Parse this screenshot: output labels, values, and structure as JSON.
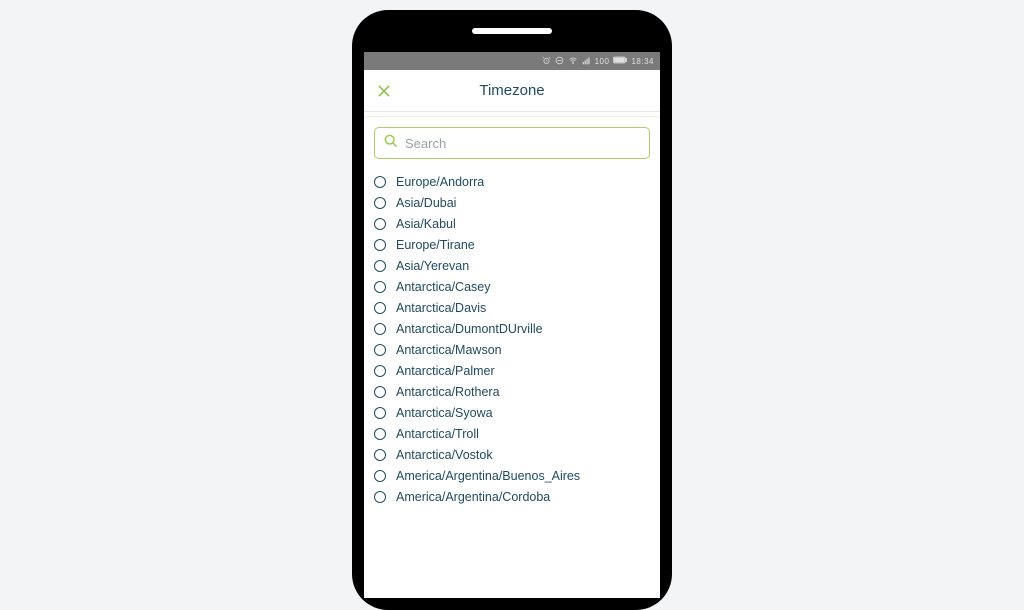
{
  "statusbar": {
    "battery_text": "100",
    "time": "18:34"
  },
  "header": {
    "title": "Timezone"
  },
  "search": {
    "placeholder": "Search"
  },
  "timezones": [
    "Europe/Andorra",
    "Asia/Dubai",
    "Asia/Kabul",
    "Europe/Tirane",
    "Asia/Yerevan",
    "Antarctica/Casey",
    "Antarctica/Davis",
    "Antarctica/DumontDUrville",
    "Antarctica/Mawson",
    "Antarctica/Palmer",
    "Antarctica/Rothera",
    "Antarctica/Syowa",
    "Antarctica/Troll",
    "Antarctica/Vostok",
    "America/Argentina/Buenos_Aires",
    "America/Argentina/Cordoba"
  ],
  "colors": {
    "accent": "#8bc34a",
    "text": "#1f4a5f"
  }
}
